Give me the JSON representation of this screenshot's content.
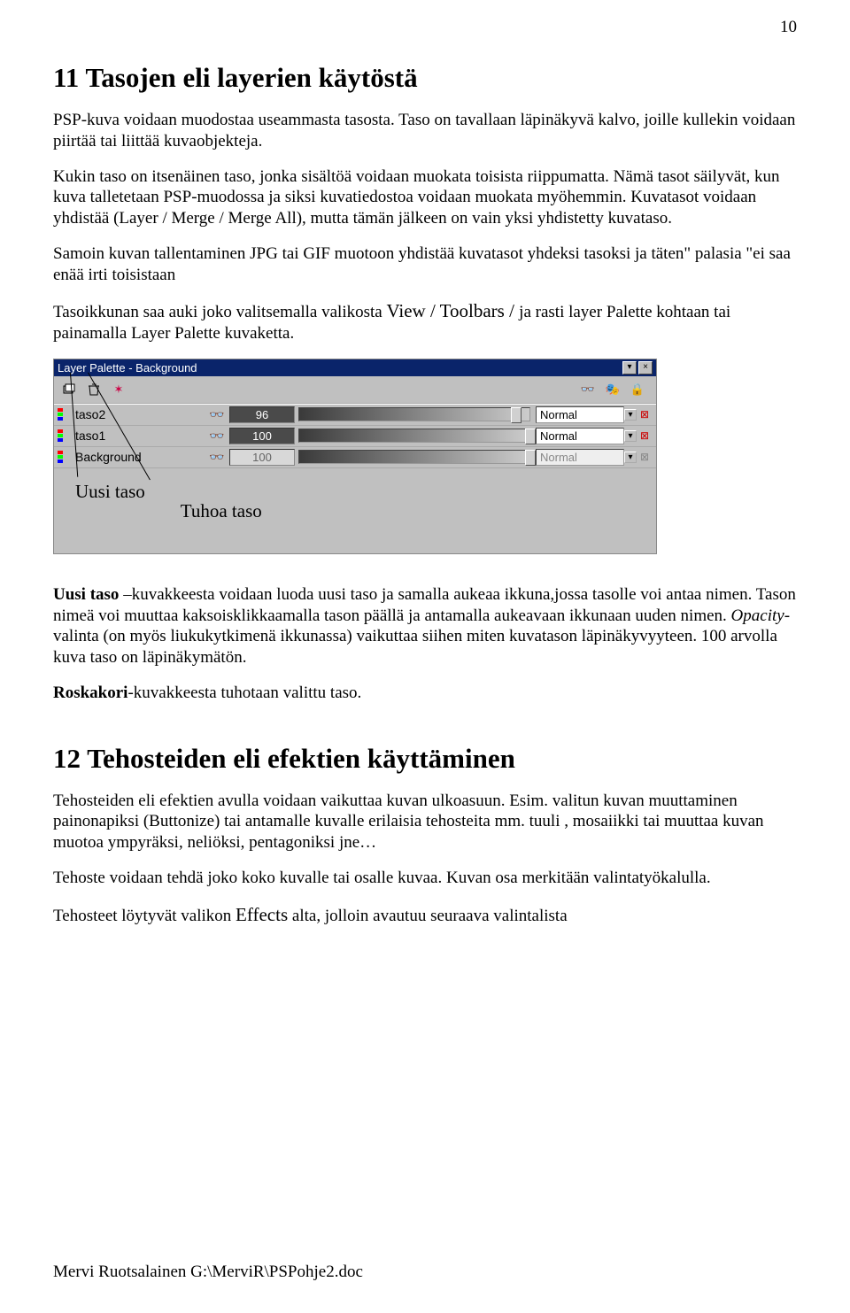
{
  "page_number": "10",
  "section11_title": "11 Tasojen eli layerien  käytöstä",
  "para1a": "PSP-kuva voidaan muodostaa useammasta tasosta. Taso on tavallaan läpinäkyvä kalvo, joille kullekin voidaan piirtää tai liittää kuvaobjekteja.",
  "para1b": "Kukin taso on itsenäinen taso, jonka sisältöä voidaan muokata toisista riippumatta. Nämä tasot säilyvät, kun kuva talletetaan PSP-muodossa ja siksi kuvatiedostoa voidaan muokata myöhemmin. Kuvatasot voidaan yhdistää (Layer / Merge / Merge All), mutta tämän jälkeen on vain yksi yhdistetty kuvataso.",
  "para2a": "Samoin kuvan tallentaminen JPG tai GIF muotoon yhdistää kuvatasot yhdeksi tasoksi ja täten\" palasia \"ei saa enää irti toisistaan",
  "para2b_pre": "Tasoikkunan saa auki joko valitsemalla valikosta ",
  "para2b_menu": "View / Toolbars / ",
  "para2b_post": " ja rasti layer Palette kohtaan tai painamalla Layer Palette kuvaketta.",
  "palette": {
    "title": "Layer Palette - Background",
    "layers": [
      {
        "name": "taso2",
        "opacity": "96",
        "mode": "Normal",
        "dim": false
      },
      {
        "name": "taso1",
        "opacity": "100",
        "mode": "Normal",
        "dim": false
      },
      {
        "name": "Background",
        "opacity": "100",
        "mode": "Normal",
        "dim": true
      }
    ],
    "annot_new": "Uusi taso",
    "annot_del": "Tuhoa taso"
  },
  "para3a": "Uusi taso",
  "para3b": " –kuvakkeesta voidaan luoda uusi taso ja samalla aukeaa ikkuna,jossa tasolle voi antaa nimen.  Tason nimeä voi muuttaa kaksoisklikkaamalla tason päällä ja antamalla aukeavaan ikkunaan uuden nimen. ",
  "para3c": "Opacity",
  "para3d": "- valinta (on myös liukukytkimenä ikkunassa) vaikuttaa siihen miten kuvatason läpinäkyvyyteen. 100 arvolla  kuva taso on läpinäkymätön.",
  "para4a": "Roskakori",
  "para4b": "-kuvakkeesta tuhotaan valittu taso.",
  "section12_title": "12 Tehosteiden eli efektien käyttäminen",
  "para5": "Tehosteiden eli efektien avulla voidaan vaikuttaa kuvan ulkoasuun. Esim. valitun kuvan muuttaminen painonapiksi (Buttonize) tai antamalle kuvalle erilaisia tehosteita mm. tuuli , mosaiikki tai muuttaa kuvan muotoa ympyräksi, neliöksi, pentagoniksi jne…",
  "para6": "Tehoste voidaan tehdä joko koko kuvalle tai  osalle kuvaa. Kuvan osa merkitään valintatyökalulla.",
  "para7a": "Tehosteet löytyvät valikon ",
  "para7b": "Effects",
  "para7c": " alta, jolloin avautuu seuraava valintalista",
  "footer": "Mervi Ruotsalainen     G:\\MerviR\\PSPohje2.doc"
}
